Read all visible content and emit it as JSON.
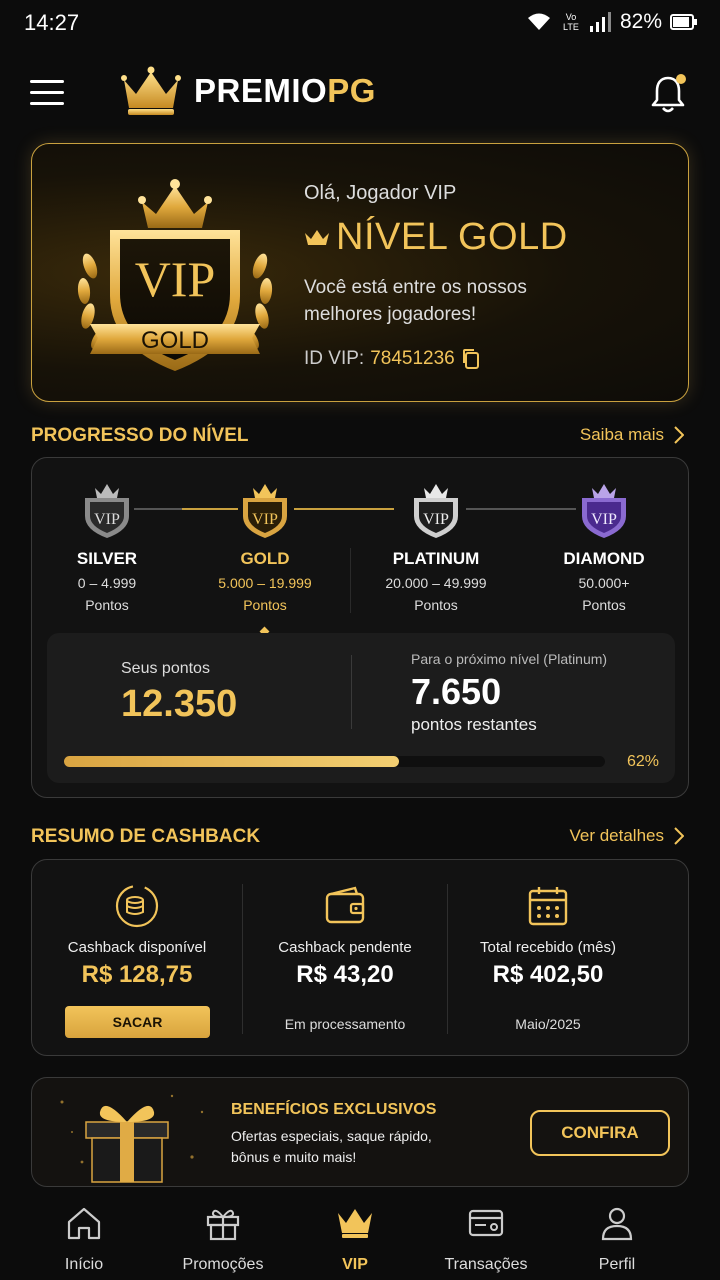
{
  "status_bar": {
    "time": "14:27",
    "network": "Vo LTE",
    "battery": "82%"
  },
  "header": {
    "logo_main": "PREMIO",
    "logo_accent": "PG"
  },
  "hero": {
    "badge_top": "VIP",
    "badge_ribbon": "GOLD",
    "greeting": "Olá, Jogador VIP",
    "level": "NÍVEL GOLD",
    "description": "Você está entre os nossos melhores jogadores!",
    "id_label": "ID VIP:",
    "id_value": "78451236"
  },
  "progress": {
    "title": "PROGRESSO DO NÍVEL",
    "link": "Saiba mais",
    "tiers": [
      {
        "name": "SILVER",
        "range": "0 – 4.999",
        "unit": "Pontos"
      },
      {
        "name": "GOLD",
        "range": "5.000 – 19.999",
        "unit": "Pontos"
      },
      {
        "name": "PLATINUM",
        "range": "20.000 – 49.999",
        "unit": "Pontos"
      },
      {
        "name": "DIAMOND",
        "range": "50.000+",
        "unit": "Pontos"
      }
    ],
    "active_tier": "GOLD",
    "points_label": "Seus pontos",
    "points_value": "12.350",
    "next_label": "Para o próximo nível (Platinum)",
    "next_value": "7.650",
    "next_sub": "pontos restantes",
    "percent_text": "62%",
    "percent": 0.62
  },
  "cashback": {
    "title": "RESUMO DE CASHBACK",
    "link": "Ver detalhes",
    "available_label": "Cashback disponível",
    "available_value": "R$ 128,75",
    "withdraw_button": "SACAR",
    "pending_label": "Cashback pendente",
    "pending_value": "R$ 43,20",
    "pending_sub": "Em processamento",
    "total_label": "Total recebido (mês)",
    "total_value": "R$ 402,50",
    "total_sub": "Maio/2025"
  },
  "benefits": {
    "title": "BENEFÍCIOS EXCLUSIVOS",
    "description": "Ofertas especiais, saque rápido, bônus e muito mais!",
    "button": "CONFIRA"
  },
  "nav": {
    "items": [
      "Início",
      "Promoções",
      "VIP",
      "Transações",
      "Perfil"
    ],
    "active": "VIP"
  },
  "colors": {
    "accent": "#f2c45a",
    "background": "#0c0c0c",
    "diamond": "#6a3fb5"
  }
}
